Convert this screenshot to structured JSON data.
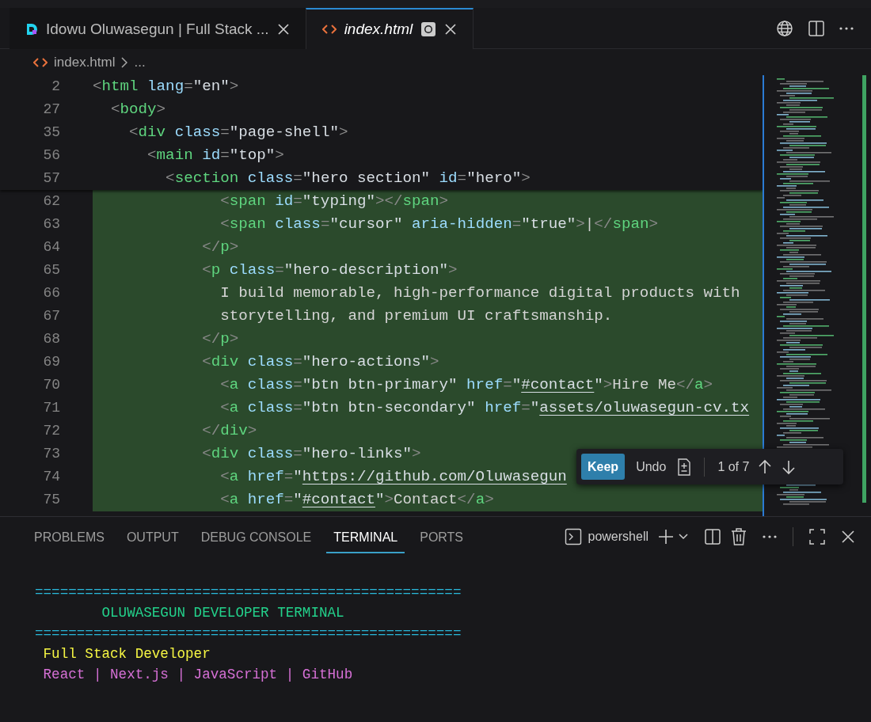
{
  "editor_tabs": [
    {
      "label": "Idowu Oluwasegun | Full Stack ...",
      "kind": "preview",
      "selected": false,
      "italic": false,
      "modified": false
    },
    {
      "label": "index.html",
      "kind": "html",
      "selected": true,
      "italic": true,
      "modified": true
    }
  ],
  "breadcrumb": [
    "index.html",
    "..."
  ],
  "sticky_lines": [
    {
      "number": "2",
      "tokens": [
        {
          "kind": "punct",
          "text": "<"
        },
        {
          "kind": "tag",
          "text": "html"
        },
        {
          "kind": "attr",
          "text": " lang"
        },
        {
          "kind": "punct",
          "text": "="
        },
        {
          "kind": "string",
          "text": "\"en\""
        },
        {
          "kind": "punct",
          "text": ">"
        }
      ]
    },
    {
      "number": "27",
      "tokens": [
        {
          "kind": "punct",
          "text": "  <"
        },
        {
          "kind": "tag",
          "text": "body"
        },
        {
          "kind": "punct",
          "text": ">"
        }
      ]
    },
    {
      "number": "35",
      "tokens": [
        {
          "kind": "punct",
          "text": "    <"
        },
        {
          "kind": "tag",
          "text": "div"
        },
        {
          "kind": "attr",
          "text": " class"
        },
        {
          "kind": "punct",
          "text": "="
        },
        {
          "kind": "string",
          "text": "\"page-shell\""
        },
        {
          "kind": "punct",
          "text": ">"
        }
      ]
    },
    {
      "number": "56",
      "tokens": [
        {
          "kind": "punct",
          "text": "      <"
        },
        {
          "kind": "tag",
          "text": "main"
        },
        {
          "kind": "attr",
          "text": " id"
        },
        {
          "kind": "punct",
          "text": "="
        },
        {
          "kind": "string",
          "text": "\"top\""
        },
        {
          "kind": "punct",
          "text": ">"
        }
      ]
    },
    {
      "number": "57",
      "tokens": [
        {
          "kind": "punct",
          "text": "        <"
        },
        {
          "kind": "tag",
          "text": "section"
        },
        {
          "kind": "attr",
          "text": " class"
        },
        {
          "kind": "punct",
          "text": "="
        },
        {
          "kind": "string",
          "text": "\"hero section\""
        },
        {
          "kind": "attr",
          "text": " id"
        },
        {
          "kind": "punct",
          "text": "="
        },
        {
          "kind": "string",
          "text": "\"hero\""
        },
        {
          "kind": "punct",
          "text": ">"
        }
      ]
    }
  ],
  "diff_lines": [
    {
      "number": "62",
      "tokens": [
        {
          "kind": "punct",
          "text": "              <"
        },
        {
          "kind": "tag",
          "text": "span"
        },
        {
          "kind": "attr",
          "text": " id"
        },
        {
          "kind": "punct",
          "text": "="
        },
        {
          "kind": "string",
          "text": "\"typing\""
        },
        {
          "kind": "punct",
          "text": "></"
        },
        {
          "kind": "tag",
          "text": "span"
        },
        {
          "kind": "punct",
          "text": ">"
        }
      ]
    },
    {
      "number": "63",
      "tokens": [
        {
          "kind": "punct",
          "text": "              <"
        },
        {
          "kind": "tag",
          "text": "span"
        },
        {
          "kind": "attr",
          "text": " class"
        },
        {
          "kind": "punct",
          "text": "="
        },
        {
          "kind": "string",
          "text": "\"cursor\""
        },
        {
          "kind": "attr",
          "text": " aria-hidden"
        },
        {
          "kind": "punct",
          "text": "="
        },
        {
          "kind": "string",
          "text": "\"true\""
        },
        {
          "kind": "punct",
          "text": ">"
        },
        {
          "kind": "text",
          "text": "|"
        },
        {
          "kind": "punct",
          "text": "</"
        },
        {
          "kind": "tag",
          "text": "span"
        },
        {
          "kind": "punct",
          "text": ">"
        }
      ]
    },
    {
      "number": "64",
      "tokens": [
        {
          "kind": "punct",
          "text": "            </"
        },
        {
          "kind": "tag",
          "text": "p"
        },
        {
          "kind": "punct",
          "text": ">"
        }
      ]
    },
    {
      "number": "65",
      "tokens": [
        {
          "kind": "punct",
          "text": "            <"
        },
        {
          "kind": "tag",
          "text": "p"
        },
        {
          "kind": "attr",
          "text": " class"
        },
        {
          "kind": "punct",
          "text": "="
        },
        {
          "kind": "string",
          "text": "\"hero-description\""
        },
        {
          "kind": "punct",
          "text": ">"
        }
      ]
    },
    {
      "number": "66",
      "tokens": [
        {
          "kind": "text",
          "text": "              I build memorable, high-performance digital products with"
        }
      ]
    },
    {
      "number": "67",
      "tokens": [
        {
          "kind": "text",
          "text": "              storytelling, and premium UI craftsmanship."
        }
      ]
    },
    {
      "number": "68",
      "tokens": [
        {
          "kind": "punct",
          "text": "            </"
        },
        {
          "kind": "tag",
          "text": "p"
        },
        {
          "kind": "punct",
          "text": ">"
        }
      ]
    },
    {
      "number": "69",
      "tokens": [
        {
          "kind": "punct",
          "text": "            <"
        },
        {
          "kind": "tag",
          "text": "div"
        },
        {
          "kind": "attr",
          "text": " class"
        },
        {
          "kind": "punct",
          "text": "="
        },
        {
          "kind": "string",
          "text": "\"hero-actions\""
        },
        {
          "kind": "punct",
          "text": ">"
        }
      ]
    },
    {
      "number": "70",
      "tokens": [
        {
          "kind": "punct",
          "text": "              <"
        },
        {
          "kind": "tag",
          "text": "a"
        },
        {
          "kind": "attr",
          "text": " class"
        },
        {
          "kind": "punct",
          "text": "="
        },
        {
          "kind": "string",
          "text": "\"btn btn-primary\""
        },
        {
          "kind": "attr",
          "text": " href"
        },
        {
          "kind": "punct",
          "text": "="
        },
        {
          "kind": "string",
          "text": "\""
        },
        {
          "kind": "link",
          "text": "#contact"
        },
        {
          "kind": "string",
          "text": "\""
        },
        {
          "kind": "punct",
          "text": ">"
        },
        {
          "kind": "text",
          "text": "Hire Me"
        },
        {
          "kind": "punct",
          "text": "</"
        },
        {
          "kind": "tag",
          "text": "a"
        },
        {
          "kind": "punct",
          "text": ">"
        }
      ]
    },
    {
      "number": "71",
      "tokens": [
        {
          "kind": "punct",
          "text": "              <"
        },
        {
          "kind": "tag",
          "text": "a"
        },
        {
          "kind": "attr",
          "text": " class"
        },
        {
          "kind": "punct",
          "text": "="
        },
        {
          "kind": "string",
          "text": "\"btn btn-secondary\""
        },
        {
          "kind": "attr",
          "text": " href"
        },
        {
          "kind": "punct",
          "text": "="
        },
        {
          "kind": "string",
          "text": "\""
        },
        {
          "kind": "link",
          "text": "assets/oluwasegun-cv.tx"
        }
      ]
    },
    {
      "number": "72",
      "tokens": [
        {
          "kind": "punct",
          "text": "            </"
        },
        {
          "kind": "tag",
          "text": "div"
        },
        {
          "kind": "punct",
          "text": ">"
        }
      ]
    },
    {
      "number": "73",
      "tokens": [
        {
          "kind": "punct",
          "text": "            <"
        },
        {
          "kind": "tag",
          "text": "div"
        },
        {
          "kind": "attr",
          "text": " class"
        },
        {
          "kind": "punct",
          "text": "="
        },
        {
          "kind": "string",
          "text": "\"hero-links\""
        },
        {
          "kind": "punct",
          "text": ">"
        }
      ]
    },
    {
      "number": "74",
      "tokens": [
        {
          "kind": "punct",
          "text": "              <"
        },
        {
          "kind": "tag",
          "text": "a"
        },
        {
          "kind": "attr",
          "text": " href"
        },
        {
          "kind": "punct",
          "text": "="
        },
        {
          "kind": "string",
          "text": "\""
        },
        {
          "kind": "link",
          "text": "https://github.com/Oluwasegun"
        }
      ]
    },
    {
      "number": "75",
      "tokens": [
        {
          "kind": "punct",
          "text": "              <"
        },
        {
          "kind": "tag",
          "text": "a"
        },
        {
          "kind": "attr",
          "text": " href"
        },
        {
          "kind": "punct",
          "text": "="
        },
        {
          "kind": "string",
          "text": "\""
        },
        {
          "kind": "link",
          "text": "#contact"
        },
        {
          "kind": "string",
          "text": "\""
        },
        {
          "kind": "punct",
          "text": ">"
        },
        {
          "kind": "text",
          "text": "Contact"
        },
        {
          "kind": "punct",
          "text": "</"
        },
        {
          "kind": "tag",
          "text": "a"
        },
        {
          "kind": "punct",
          "text": ">"
        }
      ]
    }
  ],
  "change_toolbar": {
    "keep": "Keep",
    "undo": "Undo",
    "counter": "1 of 7"
  },
  "panel": {
    "tabs": [
      {
        "label": "PROBLEMS",
        "selected": false
      },
      {
        "label": "OUTPUT",
        "selected": false
      },
      {
        "label": "DEBUG CONSOLE",
        "selected": false
      },
      {
        "label": "TERMINAL",
        "selected": true
      },
      {
        "label": "PORTS",
        "selected": false
      }
    ],
    "shell": "powershell"
  },
  "terminal": [
    {
      "kind": "rule",
      "text": "==================================================="
    },
    {
      "kind": "title",
      "text": "        OLUWASEGUN DEVELOPER TERMINAL"
    },
    {
      "kind": "rule",
      "text": "==================================================="
    },
    {
      "kind": "role",
      "text": " Full Stack Developer"
    },
    {
      "kind": "stack",
      "text": " React | Next.js | JavaScript | GitHub"
    }
  ]
}
